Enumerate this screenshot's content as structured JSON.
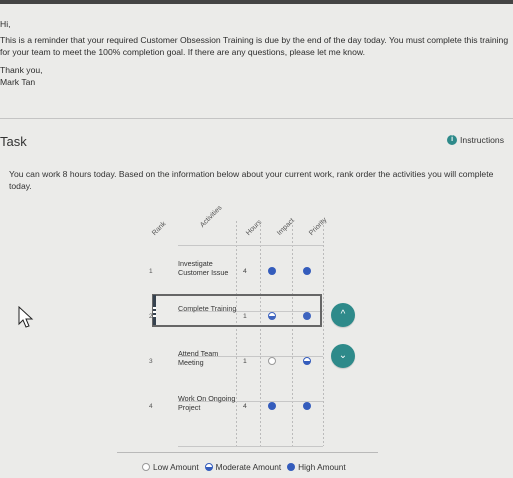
{
  "email": {
    "greeting": "Hi,",
    "body": "This is a reminder that your required Customer Obsession Training is due by the end of the day today. You must complete this training for your team to meet the 100% completion goal. If there are any questions, please let me know.",
    "signoff": "Thank you,",
    "name": "Mark Tan"
  },
  "task": {
    "title": "Task",
    "instructions_label": "Instructions",
    "description": "You can work 8 hours today. Based on the information below about your current work, rank order the activities you will complete today."
  },
  "table": {
    "headers": {
      "rank": "Rank",
      "activities": "Activities",
      "hours": "Hours",
      "impact": "Impact",
      "priority": "Priority"
    },
    "rows": [
      {
        "rank": "1",
        "activity": "Investigate Customer Issue",
        "hours": "4",
        "impact": "high",
        "priority": "high"
      },
      {
        "rank": "2",
        "activity": "Complete Training",
        "hours": "1",
        "impact": "moderate",
        "priority": "high"
      },
      {
        "rank": "3",
        "activity": "Attend Team Meeting",
        "hours": "1",
        "impact": "low",
        "priority": "moderate"
      },
      {
        "rank": "4",
        "activity": "Work On Ongoing Project",
        "hours": "4",
        "impact": "high",
        "priority": "high"
      }
    ]
  },
  "legend": {
    "low": "Low Amount",
    "moderate": "Moderate Amount",
    "high": "High Amount"
  },
  "icons": {
    "info": "info-icon",
    "up": "chevron-up-icon",
    "down": "chevron-down-icon",
    "cursor": "mouse-pointer-icon"
  },
  "colors": {
    "accent_teal": "#2e8a8a",
    "high_blue": "#345cbc",
    "handle_dark": "#36424f"
  }
}
